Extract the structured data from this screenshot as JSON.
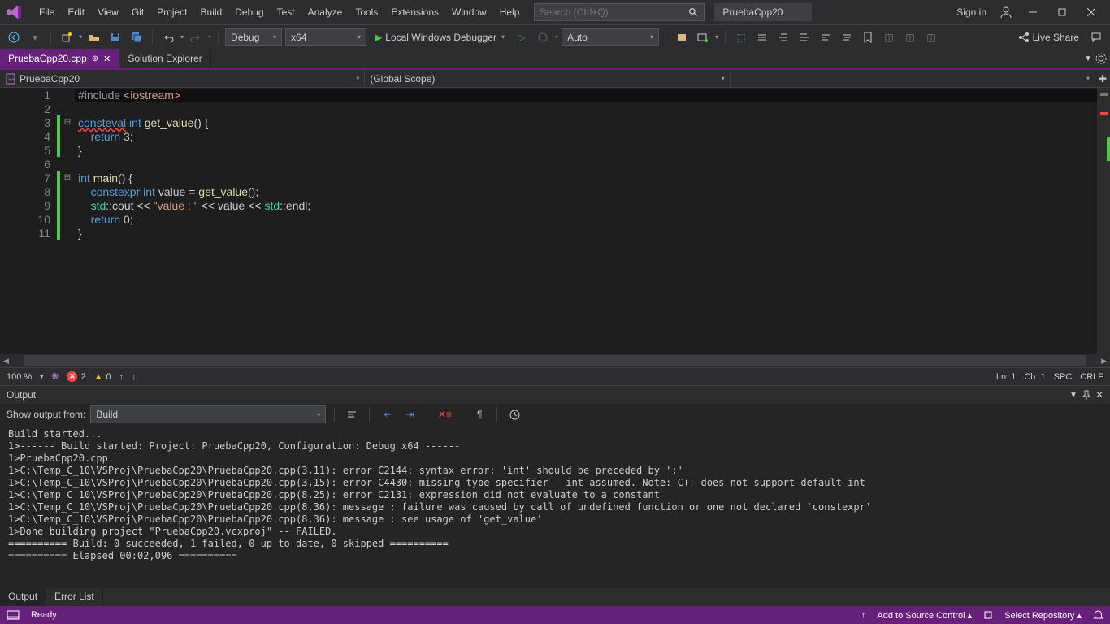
{
  "menubar": {
    "items": [
      "File",
      "Edit",
      "View",
      "Git",
      "Project",
      "Build",
      "Debug",
      "Test",
      "Analyze",
      "Tools",
      "Extensions",
      "Window",
      "Help"
    ],
    "search_placeholder": "Search (Ctrl+Q)",
    "solution_name": "PruebaCpp20",
    "signin": "Sign in"
  },
  "toolbar": {
    "config": "Debug",
    "platform": "x64",
    "debugger": "Local Windows Debugger",
    "auto": "Auto",
    "liveshare": "Live Share"
  },
  "tabs": {
    "active": "PruebaCpp20.cpp",
    "inactive": "Solution Explorer"
  },
  "navbar": {
    "project": "PruebaCpp20",
    "scope": "(Global Scope)"
  },
  "code": {
    "lines": [
      {
        "n": "1",
        "t": "include"
      },
      {
        "n": "2",
        "t": "blank"
      },
      {
        "n": "3",
        "t": "consteval"
      },
      {
        "n": "4",
        "t": "return3"
      },
      {
        "n": "5",
        "t": "brace"
      },
      {
        "n": "6",
        "t": "blank"
      },
      {
        "n": "7",
        "t": "main"
      },
      {
        "n": "8",
        "t": "constexpr"
      },
      {
        "n": "9",
        "t": "cout"
      },
      {
        "n": "10",
        "t": "return0"
      },
      {
        "n": "11",
        "t": "brace"
      }
    ]
  },
  "editor_status": {
    "zoom": "100 %",
    "errors": "2",
    "warnings": "0",
    "ln": "Ln: 1",
    "ch": "Ch: 1",
    "ins": "SPC",
    "eol": "CRLF"
  },
  "output": {
    "title": "Output",
    "from_label": "Show output from:",
    "from_value": "Build",
    "lines": [
      "Build started...",
      "1>------ Build started: Project: PruebaCpp20, Configuration: Debug x64 ------",
      "1>PruebaCpp20.cpp",
      "1>C:\\Temp_C_10\\VSProj\\PruebaCpp20\\PruebaCpp20.cpp(3,11): error C2144: syntax error: 'int' should be preceded by ';'",
      "1>C:\\Temp_C_10\\VSProj\\PruebaCpp20\\PruebaCpp20.cpp(3,15): error C4430: missing type specifier - int assumed. Note: C++ does not support default-int",
      "1>C:\\Temp_C_10\\VSProj\\PruebaCpp20\\PruebaCpp20.cpp(8,25): error C2131: expression did not evaluate to a constant",
      "1>C:\\Temp_C_10\\VSProj\\PruebaCpp20\\PruebaCpp20.cpp(8,36): message : failure was caused by call of undefined function or one not declared 'constexpr'",
      "1>C:\\Temp_C_10\\VSProj\\PruebaCpp20\\PruebaCpp20.cpp(8,36): message : see usage of 'get_value'",
      "1>Done building project \"PruebaCpp20.vcxproj\" -- FAILED.",
      "========== Build: 0 succeeded, 1 failed, 0 up-to-date, 0 skipped ==========",
      "========== Elapsed 00:02,096 =========="
    ]
  },
  "bottom_tabs": {
    "output": "Output",
    "errorlist": "Error List"
  },
  "statusbar": {
    "ready": "Ready",
    "source_control": "Add to Source Control",
    "repo": "Select Repository"
  }
}
